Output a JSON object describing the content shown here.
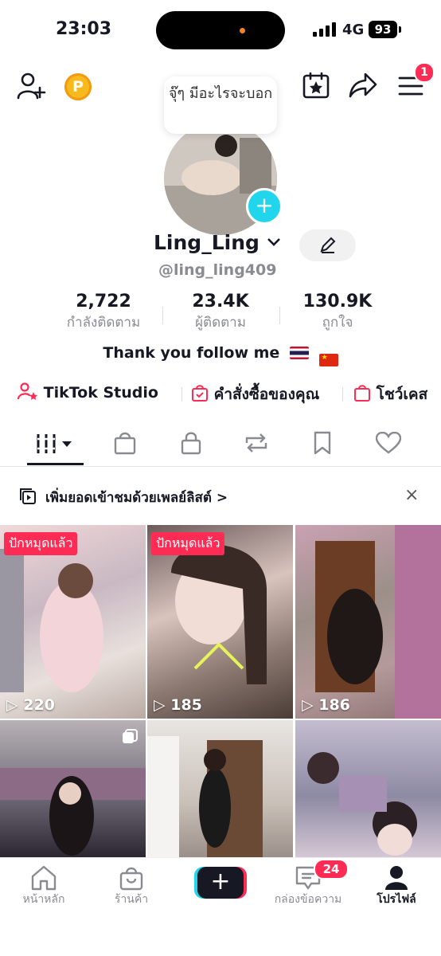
{
  "status_bar": {
    "time": "23:03",
    "network": "4G",
    "battery": "93"
  },
  "header": {
    "coin_label": "P",
    "menu_badge": "1"
  },
  "profile": {
    "note": "จุ๊ๆ มีอะไรจะบอก",
    "username": "Ling_Ling",
    "handle": "@ling_ling409",
    "stats": [
      {
        "value": "2,722",
        "label": "กำลังติดตาม"
      },
      {
        "value": "23.4K",
        "label": "ผู้ติดตาม"
      },
      {
        "value": "130.9K",
        "label": "ถูกใจ"
      }
    ],
    "bio": "Thank you follow me"
  },
  "links": [
    {
      "label": "TikTok Studio",
      "icon": "person-star-icon"
    },
    {
      "label": "คำสั่งซื้อของคุณ",
      "icon": "order-bag-icon"
    },
    {
      "label": "โชว์เคส",
      "icon": "shopping-bag-icon"
    }
  ],
  "tabs": [
    "videos-grid-icon",
    "shop-bag-icon",
    "lock-icon",
    "repost-icon",
    "bookmark-icon",
    "heart-icon"
  ],
  "playlist_banner": {
    "text": "เพิ่มยอดเข้าชมด้วยเพลย์ลิสต์ >",
    "close": "×"
  },
  "videos": [
    {
      "pinned": "ปักหมุดแล้ว",
      "views": "220"
    },
    {
      "pinned": "ปักหมุดแล้ว",
      "views": "185"
    },
    {
      "pinned": "",
      "views": "186"
    },
    {
      "pinned": "",
      "views": ""
    },
    {
      "pinned": "",
      "views": ""
    },
    {
      "pinned": "",
      "views": ""
    }
  ],
  "bottom_nav": [
    {
      "label": "หน้าหลัก",
      "icon": "home-icon"
    },
    {
      "label": "ร้านค้า",
      "icon": "shop-icon"
    },
    {
      "label": "+",
      "icon": "create-icon"
    },
    {
      "label": "กล่องข้อความ",
      "icon": "inbox-icon",
      "badge": "24"
    },
    {
      "label": "โปรไฟล์",
      "icon": "profile-icon"
    }
  ],
  "colors": {
    "accent": "#fe2c55",
    "cyan": "#20d5ec",
    "text": "#161823",
    "muted": "#8a8b91"
  }
}
